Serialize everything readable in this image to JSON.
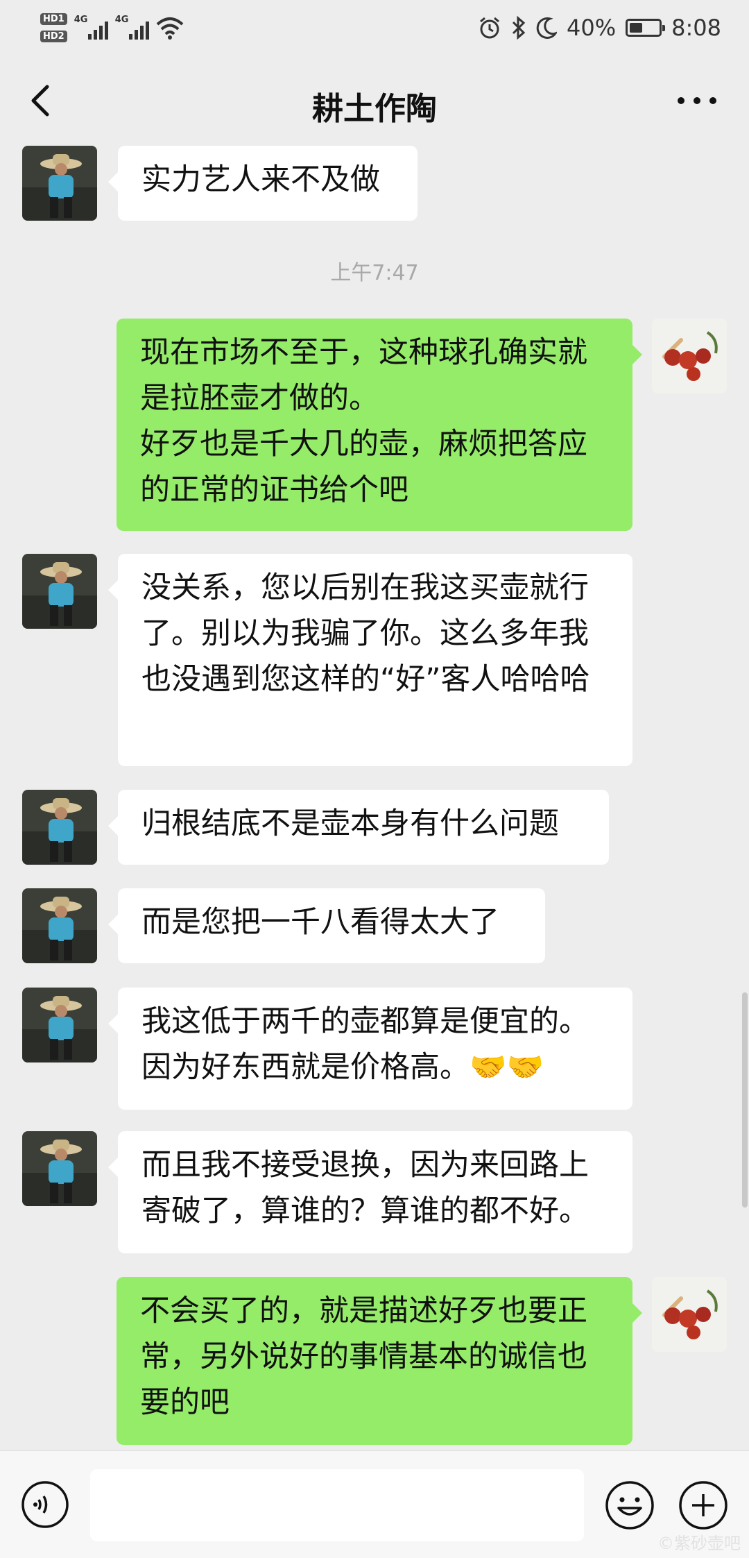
{
  "status": {
    "hd1": "HD1",
    "hd2": "HD2",
    "net1": "4G",
    "net2": "4G",
    "battery": "40%",
    "time": "8:08"
  },
  "header": {
    "title": "耕土作陶"
  },
  "chat": {
    "timestamp": "上午7:47",
    "messages": [
      {
        "dir": "in",
        "text": "实力艺人来不及做"
      },
      {
        "dir": "out",
        "text": "现在市场不至于，这种球孔确实就是拉胚壶才做的。\n好歹也是千大几的壶，麻烦把答应的正常的证书给个吧"
      },
      {
        "dir": "in",
        "text": "没关系，您以后别在我这买壶就行了。别以为我骗了你。这么多年我也没遇到您这样的“好”客人哈哈哈"
      },
      {
        "dir": "in",
        "text": "归根结底不是壶本身有什么问题"
      },
      {
        "dir": "in",
        "text": "而是您把一千八看得太大了"
      },
      {
        "dir": "in",
        "text": "我这低于两千的壶都算是便宜的。因为好东西就是价格高。🤝🤝"
      },
      {
        "dir": "in",
        "text": "而且我不接受退换，因为来回路上寄破了，算谁的？算谁的都不好。"
      },
      {
        "dir": "out",
        "text": "不会买了的，就是描述好歹也要正常，另外说好的事情基本的诚信也要的吧"
      }
    ]
  },
  "input": {
    "text": ""
  },
  "watermark": "©紫砂壶吧",
  "colors": {
    "sent_bubble": "#95ec69",
    "received_bubble": "#ffffff",
    "background": "#ededed"
  }
}
